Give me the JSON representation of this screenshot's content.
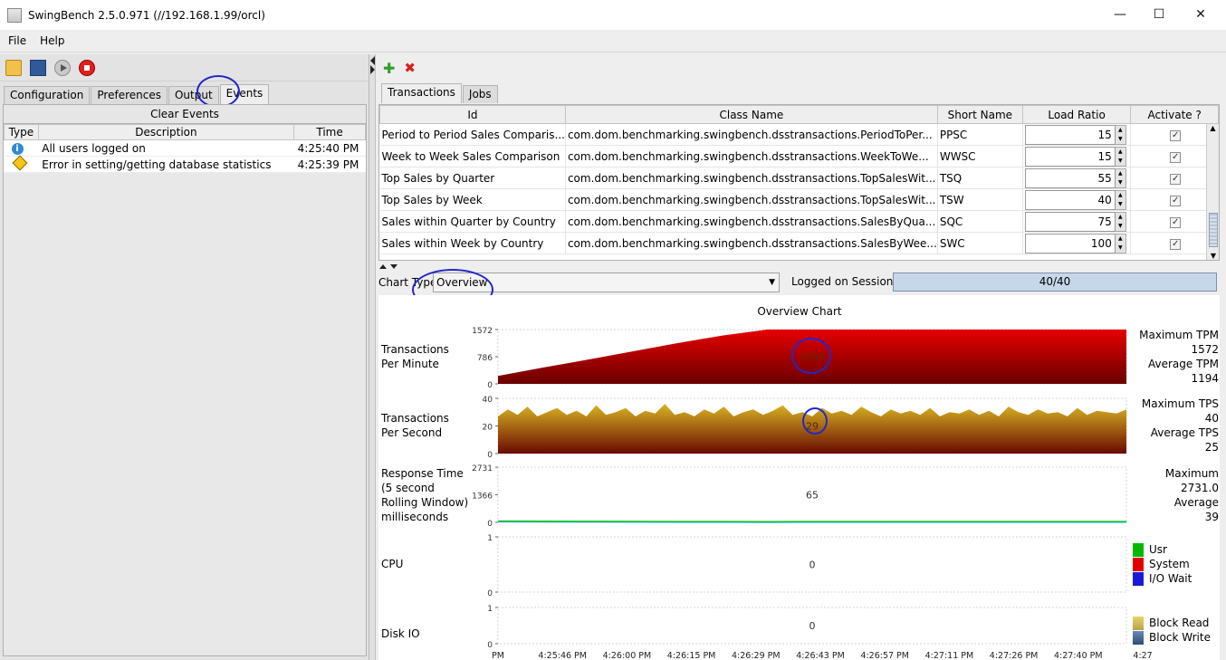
{
  "window": {
    "title": "SwingBench 2.5.0.971  (//192.168.1.99/orcl)"
  },
  "menu": [
    "File",
    "Help"
  ],
  "left": {
    "tabs": [
      "Configuration",
      "Preferences",
      "Output",
      "Events"
    ],
    "active_tab": "Events",
    "clear_label": "Clear Events",
    "columns": [
      "Type",
      "Description",
      "Time"
    ],
    "rows": [
      {
        "type_icon": "info-icon",
        "description": "All users logged on",
        "time": "4:25:40 PM"
      },
      {
        "type_icon": "warning-icon",
        "description": "Error in setting/getting database statistics",
        "time": "4:25:39 PM"
      }
    ]
  },
  "right": {
    "tabs": [
      "Transactions",
      "Jobs"
    ],
    "active_tab": "Transactions",
    "columns": [
      "Id",
      "Class Name",
      "Short Name",
      "Load Ratio",
      "Activate ?"
    ],
    "rows": [
      {
        "id": "Period to Period Sales Comparis...",
        "class": "com.dom.benchmarking.swingbench.dsstransactions.PeriodToPer...",
        "short": "PPSC",
        "ratio": "15",
        "active": true
      },
      {
        "id": "Week to Week Sales Comparison",
        "class": "com.dom.benchmarking.swingbench.dsstransactions.WeekToWe...",
        "short": "WWSC",
        "ratio": "15",
        "active": true
      },
      {
        "id": "Top Sales by Quarter",
        "class": "com.dom.benchmarking.swingbench.dsstransactions.TopSalesWit...",
        "short": "TSQ",
        "ratio": "55",
        "active": true
      },
      {
        "id": "Top Sales by Week",
        "class": "com.dom.benchmarking.swingbench.dsstransactions.TopSalesWit...",
        "short": "TSW",
        "ratio": "40",
        "active": true
      },
      {
        "id": "Sales within Quarter by Country",
        "class": "com.dom.benchmarking.swingbench.dsstransactions.SalesByQua...",
        "short": "SQC",
        "ratio": "75",
        "active": true
      },
      {
        "id": "Sales within Week by Country",
        "class": "com.dom.benchmarking.swingbench.dsstransactions.SalesByWee...",
        "short": "SWC",
        "ratio": "100",
        "active": true
      }
    ],
    "chart_type_label": "Chart Type",
    "chart_type_value": "Overview",
    "sessions_label": "Logged on Sessions",
    "sessions_value": "40/40"
  },
  "chart_data": {
    "type": "area",
    "title": "Overview Chart",
    "x_ticks": [
      "PM",
      "4:25:46 PM",
      "4:26:00 PM",
      "4:26:15 PM",
      "4:26:29 PM",
      "4:26:43 PM",
      "4:26:57 PM",
      "4:27:11 PM",
      "4:27:26 PM",
      "4:27:40 PM",
      "4:27"
    ],
    "panels": [
      {
        "label": "Transactions Per Minute",
        "ylim": [
          0,
          1572
        ],
        "y_ticks": [
          "1572",
          "786",
          "0"
        ],
        "current": "1556",
        "stats": [
          "Maximum TPM",
          "1572",
          "Average TPM",
          "1194"
        ],
        "values": [
          230,
          470,
          700,
          940,
          1180,
          1400,
          1572,
          1572,
          1572,
          1572,
          1572,
          1572,
          1572,
          1572,
          1572
        ]
      },
      {
        "label": "Transactions Per Second",
        "ylim": [
          0,
          40
        ],
        "y_ticks": [
          "40",
          "20",
          "0"
        ],
        "current": "29",
        "stats": [
          "Maximum TPS",
          "40",
          "Average TPS",
          "25"
        ],
        "values": [
          27,
          32,
          28,
          34,
          27,
          30,
          33,
          28,
          31,
          27,
          35,
          28,
          30,
          33,
          27,
          31,
          29,
          36,
          28,
          30,
          27,
          32,
          29,
          34,
          27,
          30,
          32,
          28,
          31,
          35,
          28,
          30,
          27,
          33,
          29,
          31,
          28,
          34,
          30,
          27,
          32,
          29,
          31,
          28,
          33,
          27,
          30,
          29,
          32,
          28,
          31,
          27,
          34,
          30,
          28,
          32,
          29,
          30,
          27,
          33,
          28,
          31,
          30,
          29,
          32
        ]
      },
      {
        "label": "Response Time (5 second Rolling Window) milliseconds",
        "ylim": [
          0,
          2731
        ],
        "y_ticks": [
          "2731",
          "1366",
          "0"
        ],
        "current": "65",
        "stats": [
          "Maximum",
          "2731.0",
          "Average",
          "39"
        ],
        "values": [
          60,
          55,
          50,
          45,
          40,
          38,
          36,
          40,
          38,
          37,
          39,
          41,
          40,
          38,
          39
        ]
      },
      {
        "label": "CPU",
        "ylim": [
          0,
          1
        ],
        "y_ticks": [
          "1",
          "0"
        ],
        "current": "0",
        "legend": [
          {
            "name": "Usr",
            "color": "#00b800"
          },
          {
            "name": "System",
            "color": "#e00000"
          },
          {
            "name": "I/O Wait",
            "color": "#1a1ad6"
          }
        ]
      },
      {
        "label": "Disk IO",
        "ylim": [
          0,
          1
        ],
        "y_ticks": [
          "1",
          "0"
        ],
        "current": "0",
        "legend": [
          {
            "name": "Block Read",
            "color": "#d9c46a"
          },
          {
            "name": "Block Write",
            "color": "#4a6d97"
          }
        ]
      }
    ]
  }
}
